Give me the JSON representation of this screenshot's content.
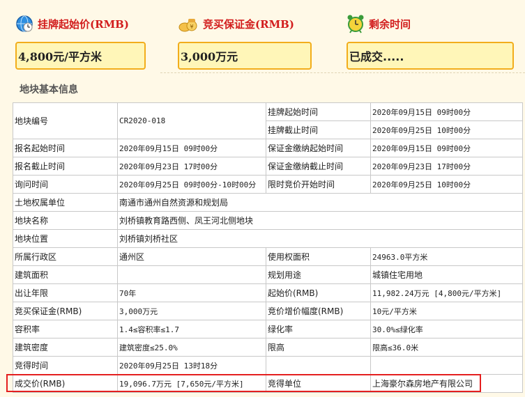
{
  "header": {
    "start_price": {
      "label": "挂牌起始价(RMB)",
      "value": "4,800元/平方米",
      "icon": "clock-globe-icon"
    },
    "deposit": {
      "label": "竞买保证金(RMB)",
      "value": "3,000万元",
      "icon": "money-bag-icon"
    },
    "remaining": {
      "label": "剩余时间",
      "value": "已成交.....",
      "icon": "alarm-clock-icon"
    }
  },
  "section_title": "地块基本信息",
  "rows": {
    "r1": {
      "k1": "地块编号",
      "v1": "CR2020-018",
      "k2a": "挂牌起始时间",
      "v2a": "2020年09月15日 09时00分",
      "k2b": "挂牌截止时间",
      "v2b": "2020年09月25日 10时00分"
    },
    "r2": {
      "k1": "报名起始时间",
      "v1": "2020年09月15日 09时00分",
      "k2": "保证金缴纳起始时间",
      "v2": "2020年09月15日 09时00分"
    },
    "r3": {
      "k1": "报名截止时间",
      "v1": "2020年09月23日 17时00分",
      "k2": "保证金缴纳截止时间",
      "v2": "2020年09月23日 17时00分"
    },
    "r4": {
      "k1": "询问时间",
      "v1": "2020年09月25日 09时00分-10时00分",
      "k2": "限时竞价开始时间",
      "v2": "2020年09月25日 10时00分"
    },
    "r5": {
      "k1": "土地权属单位",
      "v1": "南通市通州自然资源和规划局"
    },
    "r6": {
      "k1": "地块名称",
      "v1": "刘桥镇教育路西侧、凤王河北侧地块"
    },
    "r7": {
      "k1": "地块位置",
      "v1": "刘桥镇刘桥社区"
    },
    "r8": {
      "k1": "所属行政区",
      "v1": "通州区",
      "k2": "使用权面积",
      "v2": "24963.0平方米"
    },
    "r9": {
      "k1": "建筑面积",
      "v1": "",
      "k2": "规划用途",
      "v2": "城镇住宅用地"
    },
    "r10": {
      "k1": "出让年限",
      "v1": "70年",
      "k2": "起始价(RMB)",
      "v2": "11,982.24万元 [4,800元/平方米]"
    },
    "r11": {
      "k1": "竞买保证金(RMB)",
      "v1": "3,000万元",
      "k2": "竞价增价幅度(RMB)",
      "v2": "10元/平方米"
    },
    "r12": {
      "k1": "容积率",
      "v1": "1.4≤容积率≤1.7",
      "k2": "绿化率",
      "v2": "30.0%≤绿化率"
    },
    "r13": {
      "k1": "建筑密度",
      "v1": "建筑密度≤25.0%",
      "k2": "限高",
      "v2": "限高≤36.0米"
    },
    "r14": {
      "k1": "竞得时间",
      "v1": "2020年09月25日 13时18分",
      "k2": "",
      "v2": ""
    },
    "r15": {
      "k1": "成交价(RMB)",
      "v1": "19,096.7万元 [7,650元/平方米]",
      "k2": "竞得单位",
      "v2": "上海豪尔森房地产有限公司"
    }
  },
  "colors": {
    "accent_red": "#d21d1d",
    "box_border": "#f2ad1b",
    "box_fill": "#fff6b8",
    "page_bg": "#fff9e7",
    "highlight": "#e41f1f"
  }
}
